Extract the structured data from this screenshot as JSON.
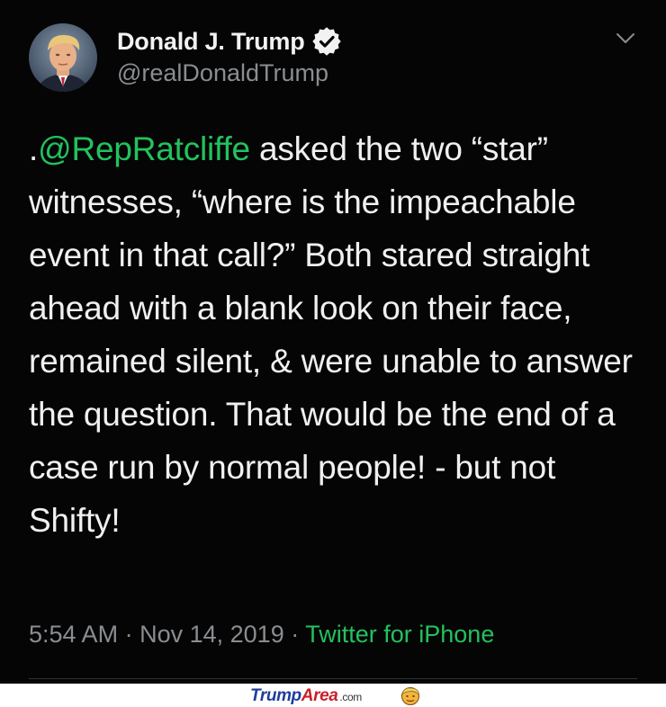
{
  "tweet": {
    "display_name": "Donald J. Trump",
    "handle": "@realDonaldTrump",
    "verified_icon": "verified-badge-icon",
    "menu_icon": "chevron-down-icon",
    "body_prefix": ".",
    "mention": "@RepRatcliffe",
    "body_text": " asked the two “star” witnesses, “where is the impeachable event in that call?” Both stared straight ahead with a blank look on their face, remained silent, & were unable to answer the question. That would be the end of a case run by normal people! - but not Shifty!",
    "time": "5:54 AM",
    "separator": "·",
    "date": "Nov 14, 2019",
    "source": "Twitter for iPhone"
  },
  "footer": {
    "brand_part1": "Trump",
    "brand_part2": "Area",
    "brand_part3": ".com",
    "mascot_icon": "trump-face-icon"
  },
  "colors": {
    "background": "#050505",
    "accent": "#22c25e",
    "muted": "#8a8d91",
    "brand_blue": "#1f3c9c",
    "brand_red": "#c8202a"
  }
}
